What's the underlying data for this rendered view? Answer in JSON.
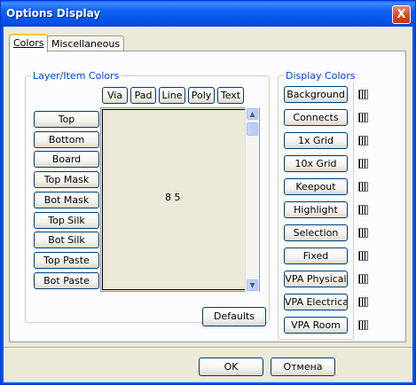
{
  "window": {
    "title": "Options Display",
    "close_glyph": "X"
  },
  "tabs": [
    {
      "label": "Colors",
      "active": true
    },
    {
      "label": "Miscellaneous",
      "active": false
    }
  ],
  "layer_group": {
    "legend": "Layer/Item Colors",
    "item_headers": [
      "Via",
      "Pad",
      "Line",
      "Poly",
      "Text"
    ],
    "layers": [
      "Top",
      "Bottom",
      "Board",
      "Top Mask",
      "Bot Mask",
      "Top Silk",
      "Bot Silk",
      "Top Paste",
      "Bot Paste"
    ],
    "grid_label": "8 5"
  },
  "display_group": {
    "legend": "Display Colors",
    "items": [
      "Background",
      "Connects",
      "1x Grid",
      "10x Grid",
      "Keepout",
      "Highlight",
      "Selection",
      "Fixed",
      "VPA Physical",
      "VPA Electrical",
      "VPA Room"
    ]
  },
  "buttons": {
    "defaults": "Defaults",
    "ok": "OK",
    "cancel": "Отмена"
  }
}
